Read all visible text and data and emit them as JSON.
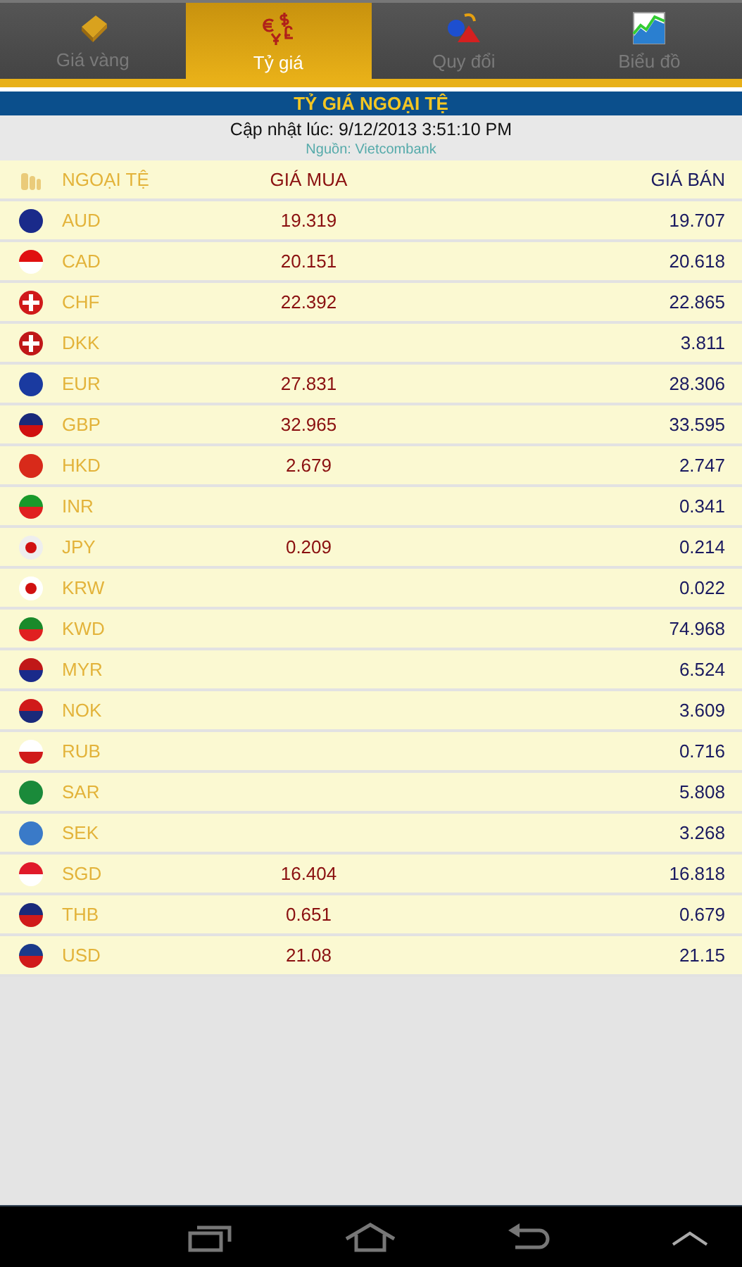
{
  "tabs": [
    {
      "label": "Giá vàng",
      "selected": false
    },
    {
      "label": "Tỷ giá",
      "selected": true
    },
    {
      "label": "Quy đổi",
      "selected": false
    },
    {
      "label": "Biểu đồ",
      "selected": false
    }
  ],
  "title": "TỶ GIÁ NGOẠI TỆ",
  "updated": "Cập nhật lúc: 9/12/2013 3:51:10 PM",
  "source": "Nguồn: Vietcombank",
  "columns": [
    "NGOẠI TỆ",
    "GIÁ MUA",
    "GIÁ BÁN"
  ],
  "rows": [
    {
      "code": "AUD",
      "buy": "19.319",
      "sell": "19.707"
    },
    {
      "code": "CAD",
      "buy": "20.151",
      "sell": "20.618"
    },
    {
      "code": "CHF",
      "buy": "22.392",
      "sell": "22.865"
    },
    {
      "code": "DKK",
      "sell": "3.811"
    },
    {
      "code": "EUR",
      "buy": "27.831",
      "sell": "28.306"
    },
    {
      "code": "GBP",
      "buy": "32.965",
      "sell": "33.595"
    },
    {
      "code": "HKD",
      "buy": "2.679",
      "sell": "2.747"
    },
    {
      "code": "INR",
      "sell": "0.341"
    },
    {
      "code": "JPY",
      "buy": "0.209",
      "sell": "0.214"
    },
    {
      "code": "KRW",
      "sell": "0.022"
    },
    {
      "code": "KWD",
      "sell": "74.968"
    },
    {
      "code": "MYR",
      "sell": "6.524"
    },
    {
      "code": "NOK",
      "sell": "3.609"
    },
    {
      "code": "RUB",
      "sell": "0.716"
    },
    {
      "code": "SAR",
      "sell": "5.808"
    },
    {
      "code": "SEK",
      "sell": "3.268"
    },
    {
      "code": "SGD",
      "buy": "16.404",
      "sell": "16.818"
    },
    {
      "code": "THB",
      "buy": "0.651",
      "sell": "0.679"
    },
    {
      "code": "USD",
      "buy": "21.08",
      "sell": "21.15"
    }
  ]
}
